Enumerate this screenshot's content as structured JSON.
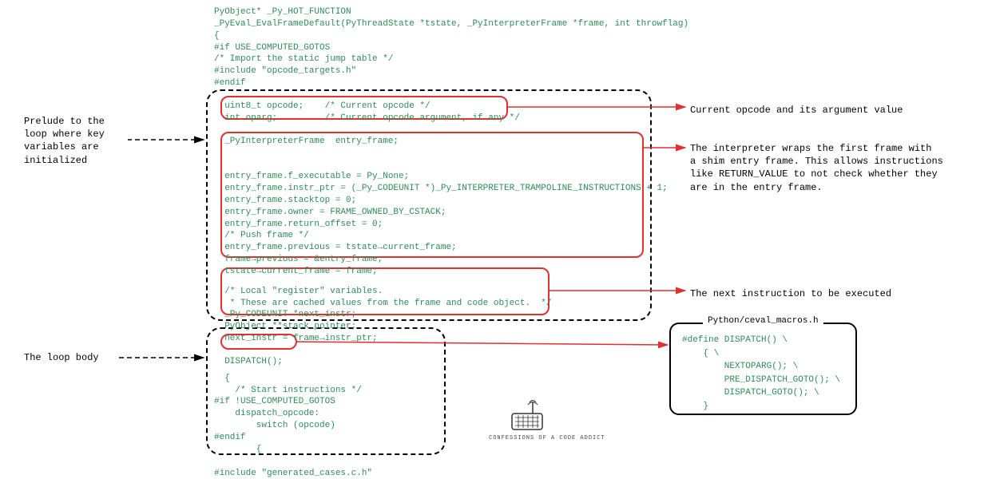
{
  "code": {
    "header": "PyObject* _Py_HOT_FUNCTION\n_PyEval_EvalFrameDefault(PyThreadState *tstate, _PyInterpreterFrame *frame, int throwflag)\n{\n#if USE_COMPUTED_GOTOS\n/* Import the static jump table */\n#include \"opcode_targets.h\"\n#endif",
    "opcode_block": "  uint8_t opcode;    /* Current opcode */\n  int oparg;         /* Current opcode argument, if any */",
    "entry_block": "  _PyInterpreterFrame  entry_frame;\n\n\n  entry_frame.f_executable = Py_None;\n  entry_frame.instr_ptr = (_Py_CODEUNIT *)_Py_INTERPRETER_TRAMPOLINE_INSTRUCTIONS + 1;\n  entry_frame.stacktop = 0;\n  entry_frame.owner = FRAME_OWNED_BY_CSTACK;\n  entry_frame.return_offset = 0;\n  /* Push frame */\n  entry_frame.previous = tstate→current_frame;\n  frame→previous = &entry_frame;\n  tstate→current_frame = frame;",
    "nextinstr_block": "  /* Local \"register\" variables.\n   * These are cached values from the frame and code object.  */\n  _Py_CODEUNIT *next_instr;\n  PyObject **stack_pointer;\n  next_instr = frame→instr_ptr;",
    "dispatch_call": "  DISPATCH();",
    "loop_body": "  {\n    /* Start instructions */\n#if !USE_COMPUTED_GOTOS\n    dispatch_opcode:\n        switch (opcode)\n#endif\n        {\n\n#include \"generated_cases.c.h\""
  },
  "annotations": {
    "left_prelude": "Prelude to the\nloop where key\nvariables are\ninitialized",
    "left_loop": "The loop body",
    "right_opcode": "Current opcode and its argument value",
    "right_entry": "The interpreter wraps the first frame with\na shim entry frame. This allows instructions\nlike RETURN_VALUE to not check whether they\nare in the entry frame.",
    "right_nextinstr": "The next instruction to be executed"
  },
  "macro_box": {
    "title": "Python/ceval_macros.h",
    "code": "#define DISPATCH() \\\n    { \\\n        NEXTOPARG(); \\\n        PRE_DISPATCH_GOTO(); \\\n        DISPATCH_GOTO(); \\\n    }"
  },
  "footer": "CONFESSIONS OF A CODE ADDICT",
  "colors": {
    "code_green": "#2e8b57",
    "highlight_red": "#e03030",
    "dash_black": "#000000"
  }
}
